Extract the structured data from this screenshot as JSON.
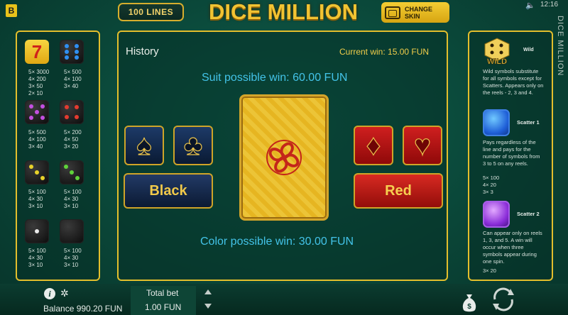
{
  "header": {
    "brand_letter": "B",
    "lines_label": "100 LINES",
    "title": "DICE MILLION",
    "change_skin_line1": "CHANGE",
    "change_skin_line2": "SKIN",
    "clock": "12:16",
    "vertical_title": "DICE MILLION"
  },
  "paytable": {
    "seven": {
      "glyph": "7",
      "pays": [
        "5× 3000",
        "4× 200",
        "3× 50",
        "2× 10"
      ]
    },
    "blue_die": {
      "pays": [
        "5× 500",
        "4× 100",
        "3× 40"
      ]
    },
    "purple_die": {
      "pays": [
        "5× 500",
        "4× 100",
        "3× 40"
      ]
    },
    "red_die": {
      "pays": [
        "5× 200",
        "4× 50",
        "3× 20"
      ]
    },
    "yellow_die": {
      "pays": [
        "5× 100",
        "4× 30",
        "3× 10"
      ]
    },
    "green_die": {
      "pays": [
        "5× 100",
        "4× 30",
        "3× 10"
      ]
    },
    "white_die": {
      "pays": [
        "5× 100",
        "4× 30",
        "3× 10"
      ]
    },
    "black_die": {
      "pays": [
        "5× 100",
        "4× 30",
        "3× 10"
      ]
    }
  },
  "gamble": {
    "history_label": "History",
    "current_win": "Current win: 15.00 FUN",
    "suit_possible_win": "Suit possible win: 60.00 FUN",
    "color_possible_win": "Color possible win: 30.00 FUN",
    "black_label": "Black",
    "red_label": "Red",
    "suits": {
      "spade": "♠",
      "club": "♣",
      "diamond": "♦",
      "heart": "♥"
    }
  },
  "rules": {
    "wild_icon_text": "WILD",
    "wild_title": "Wild",
    "wild_text": [
      "Wild symbols substitute",
      "for all symbols except for",
      "Scatters. Appears only on",
      "the reels - 2, 3 and 4."
    ],
    "scatter1_title": "Scatter 1",
    "scatter1_text": [
      "Pays regardless of the",
      "line and pays for the",
      "number of symbols from",
      "3 to 5 on any reels."
    ],
    "scatter1_pays": [
      "5× 100",
      "4× 20",
      "3× 3"
    ],
    "scatter2_title": "Scatter 2",
    "scatter2_text": [
      "Can appear only on reels",
      "1, 3, and 5. A win will",
      "occur when three",
      "symbols appear during",
      "one spin."
    ],
    "scatter2_pays": [
      "3× 20"
    ]
  },
  "footer": {
    "info_glyph": "i",
    "gear_glyph": "✲",
    "balance": "Balance 990.20 FUN",
    "total_bet_label": "Total bet",
    "total_bet_value": "1.00 FUN"
  },
  "colors": {
    "accent_gold": "#e3be2c",
    "win_cyan": "#43c3e8",
    "background_green": "#0a4638"
  }
}
